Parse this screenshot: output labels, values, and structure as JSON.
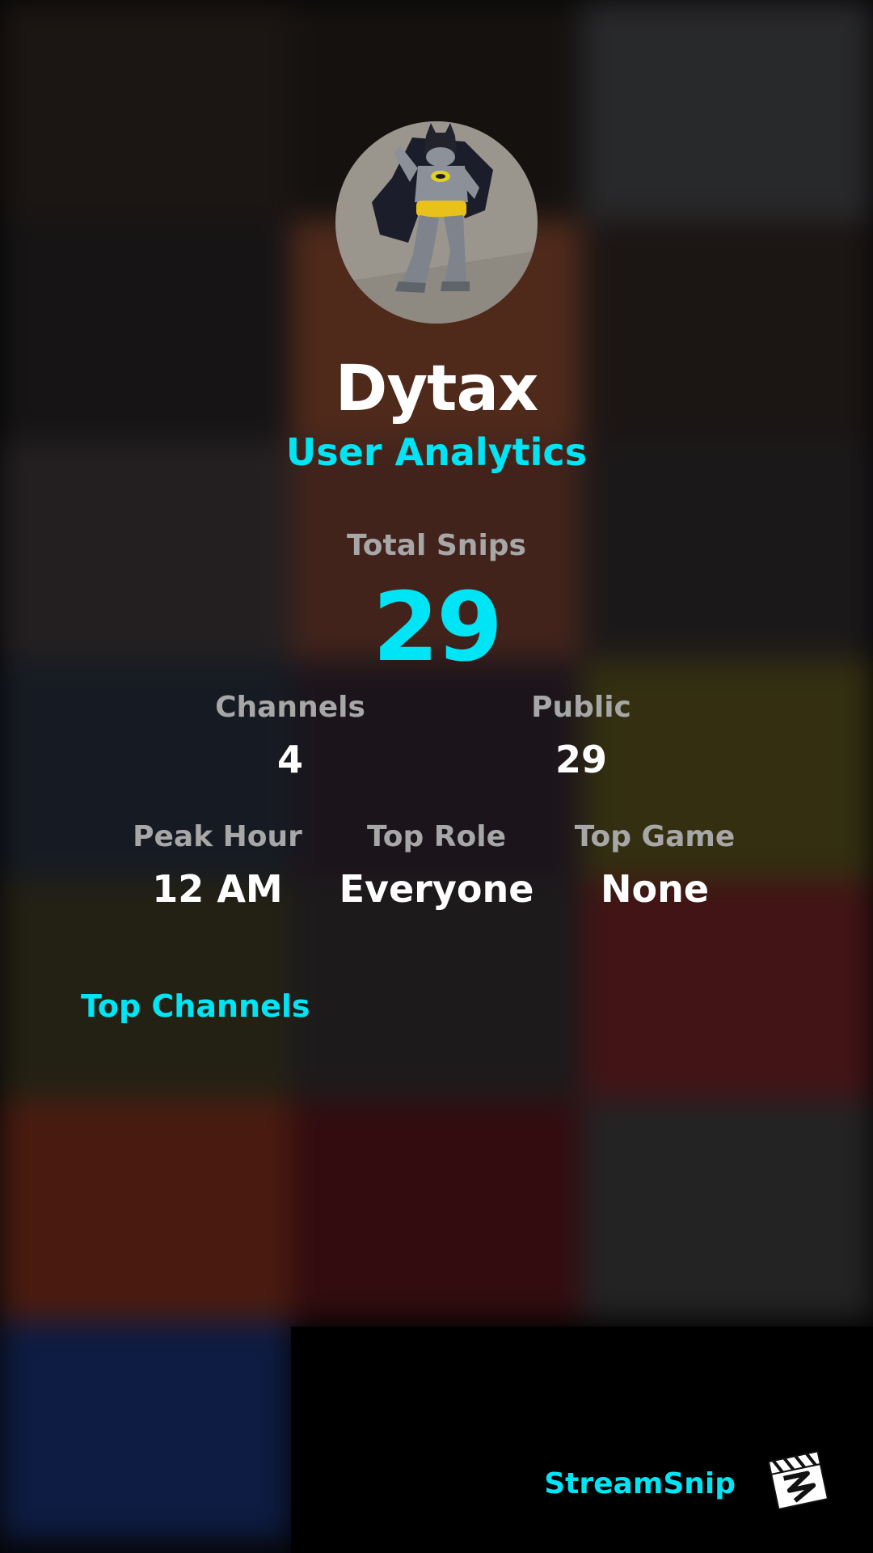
{
  "profile": {
    "username": "Dytax",
    "subtitle": "User Analytics",
    "avatar_icon": "batman-figure-icon"
  },
  "stats": {
    "total_snips": {
      "label": "Total Snips",
      "value": "29"
    },
    "channels": {
      "label": "Channels",
      "value": "4"
    },
    "public": {
      "label": "Public",
      "value": "29"
    },
    "peak_hour": {
      "label": "Peak Hour",
      "value": "12 AM"
    },
    "top_role": {
      "label": "Top Role",
      "value": "Everyone"
    },
    "top_game": {
      "label": "Top Game",
      "value": "None"
    }
  },
  "sections": {
    "top_channels": "Top Channels"
  },
  "branding": {
    "name": "StreamSnip",
    "logo_icon": "clapperboard-logo-icon"
  },
  "colors": {
    "accent": "#00e5f5",
    "label": "#a7a7a7",
    "text": "#ffffff"
  }
}
